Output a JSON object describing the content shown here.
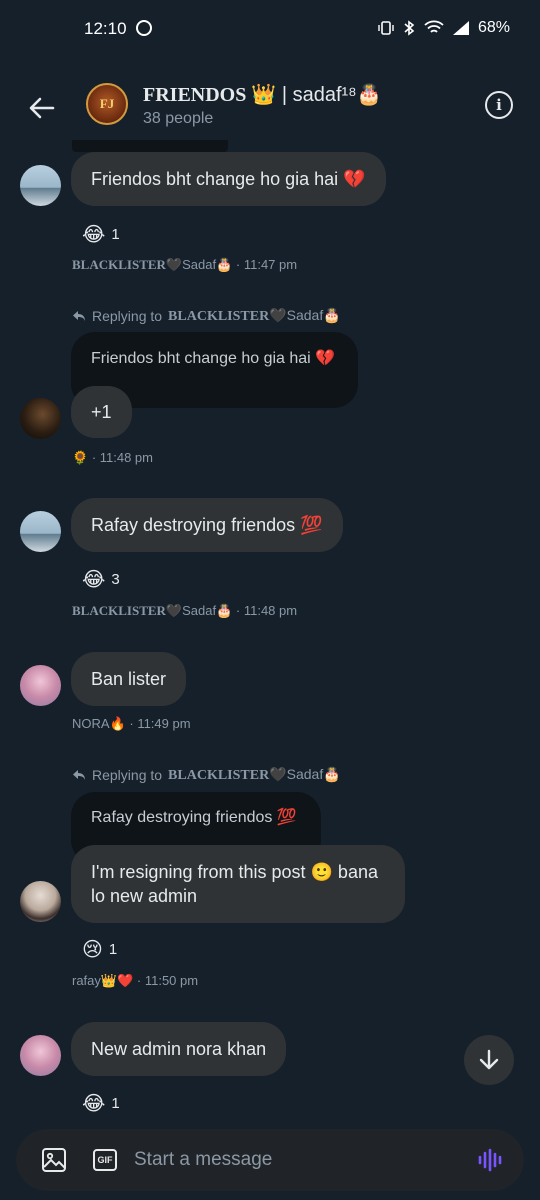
{
  "status": {
    "time": "12:10",
    "battery": "68%"
  },
  "header": {
    "group_logo_text": "FJ",
    "title_main": "FRIENDOS 👑",
    "title_rest": "| sadaf¹⁸🎂",
    "subtitle": "38 people"
  },
  "messages": [
    {
      "text": "Friendos bht change ho gia hai 💔",
      "reaction_emoji": "😂",
      "reaction_count": "1",
      "sender": "BLACKLISTER",
      "sender_suffix": "🖤Sadaf🎂",
      "time": "· 11:47 pm"
    },
    {
      "reply_prefix": "Replying to",
      "reply_name": "BLACKLISTER",
      "reply_suffix": "🖤Sadaf🎂",
      "quoted_text": "Friendos bht change ho gia hai 💔",
      "text": "+1",
      "sender": "🌻",
      "time": "· 11:48 pm"
    },
    {
      "text": "Rafay destroying friendos 💯",
      "reaction_emoji": "😂",
      "reaction_count": "3",
      "sender": "BLACKLISTER",
      "sender_suffix": "🖤Sadaf🎂",
      "time": "· 11:48 pm"
    },
    {
      "text": "Ban lister",
      "sender": "NORA🔥",
      "time": "· 11:49 pm"
    },
    {
      "reply_prefix": "Replying to",
      "reply_name": "BLACKLISTER",
      "reply_suffix": "🖤Sadaf🎂",
      "quoted_text": "Rafay destroying friendos 💯",
      "text": "I'm resigning from this post 🙂 bana lo new admin",
      "reaction_emoji": "😢",
      "reaction_count": "1",
      "sender": "rafay👑❤️",
      "time": "· 11:50 pm"
    },
    {
      "text": "New admin nora khan",
      "reaction_emoji": "😂",
      "reaction_count": "1"
    }
  ],
  "composer": {
    "placeholder": "Start a message"
  },
  "colors": {
    "background": "#15202b",
    "bubble": "#2f3336",
    "quoted_bubble": "#0f1419",
    "accent_voice": "#7856ff"
  }
}
